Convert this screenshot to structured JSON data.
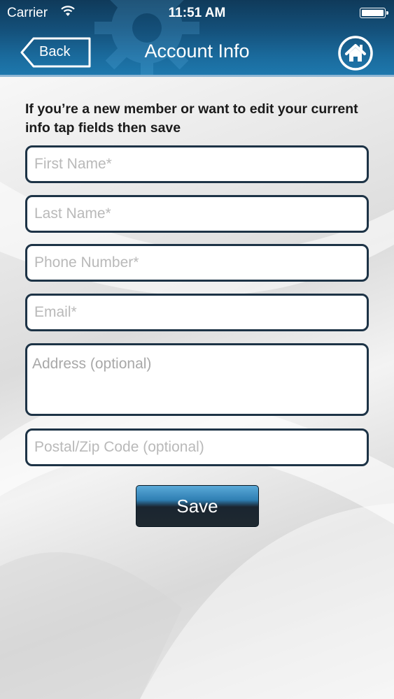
{
  "status_bar": {
    "carrier": "Carrier",
    "time": "11:51 AM"
  },
  "nav": {
    "back_label": "Back",
    "title": "Account Info",
    "home_icon": "home-icon"
  },
  "form": {
    "instructions": "If you’re a new member or want to edit your current info tap fields then save",
    "fields": [
      {
        "placeholder": "First Name*",
        "value": ""
      },
      {
        "placeholder": "Last Name*",
        "value": ""
      },
      {
        "placeholder": "Phone Number*",
        "value": ""
      },
      {
        "placeholder": "Email*",
        "value": ""
      },
      {
        "placeholder": "Address (optional)",
        "value": ""
      },
      {
        "placeholder": "Postal/Zip Code (optional)",
        "value": ""
      }
    ],
    "save_label": "Save"
  },
  "colors": {
    "header": "#1a6a9c",
    "field_border": "#1d3346",
    "placeholder": "#b9b9b9"
  }
}
